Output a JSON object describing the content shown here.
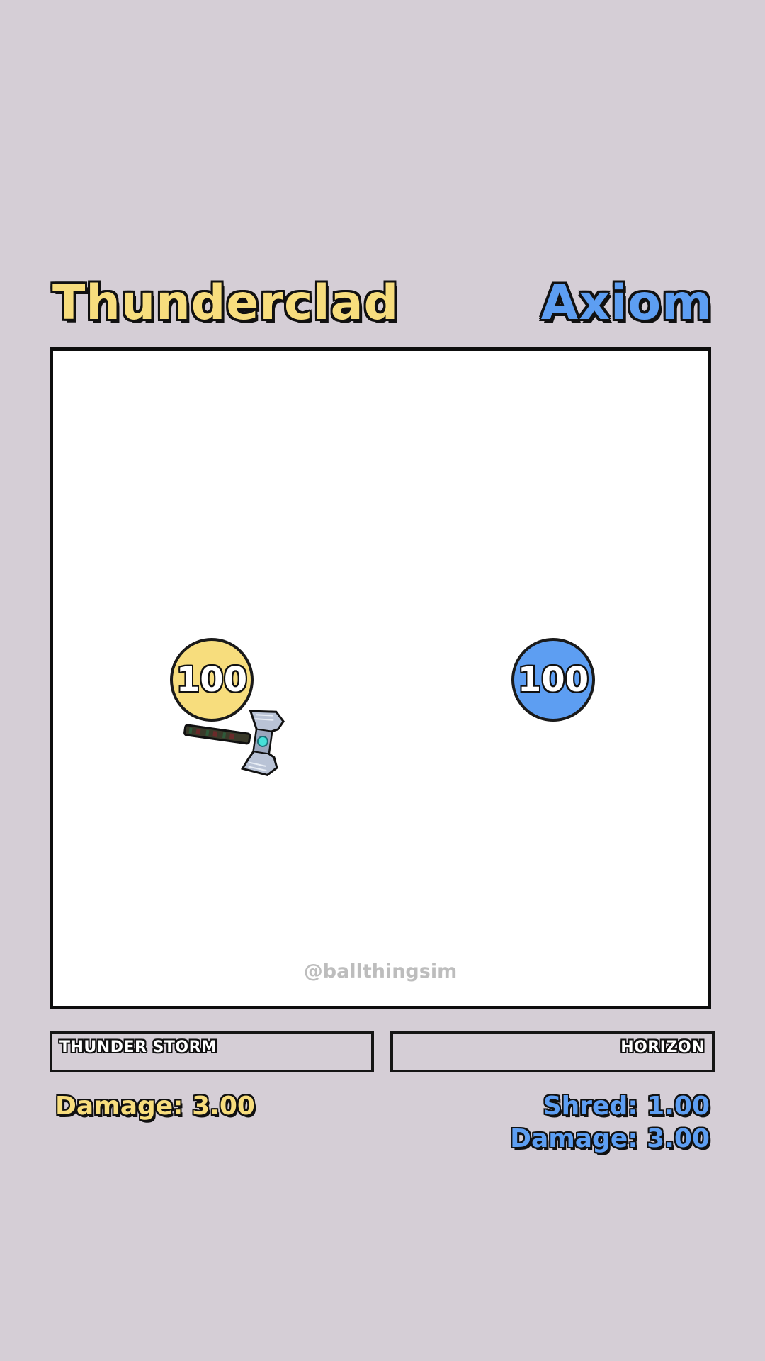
{
  "colors": {
    "left_team": "#f7dd7d",
    "right_team": "#5d9ef2",
    "background": "#d5ced6"
  },
  "left": {
    "name": "Thunderclad",
    "hp": "100",
    "ability": "THUNDER STORM",
    "stats": [
      "Damage: 3.00"
    ],
    "weapon_icon": "hammer-icon"
  },
  "right": {
    "name": "Axiom",
    "hp": "100",
    "ability": "HORIZON",
    "stats": [
      "Shred: 1.00",
      "Damage: 3.00"
    ]
  },
  "arena": {
    "watermark": "@ballthingsim"
  }
}
